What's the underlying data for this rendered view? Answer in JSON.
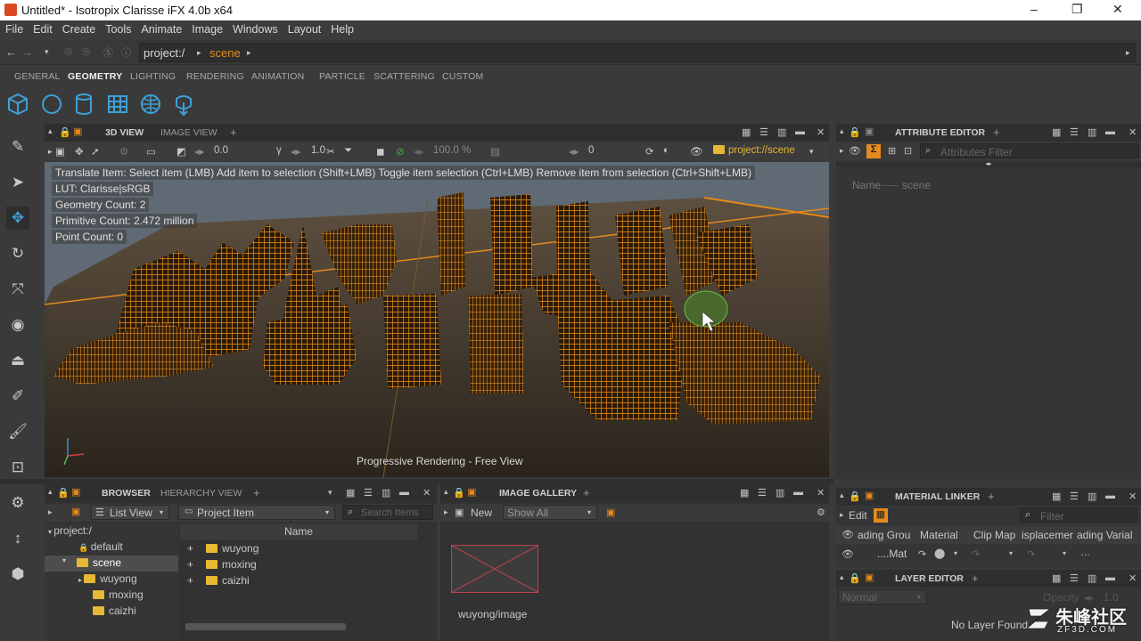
{
  "window": {
    "title": "Untitled* - Isotropix Clarisse iFX 4.0b x64",
    "minimize": "–",
    "maximize": "❐",
    "close": "✕"
  },
  "menu": [
    "File",
    "Edit",
    "Create",
    "Tools",
    "Animate",
    "Image",
    "Windows",
    "Layout",
    "Help"
  ],
  "path": {
    "root": "project:/",
    "current": "scene"
  },
  "context_tabs": [
    "GENERAL",
    "GEOMETRY",
    "LIGHTING",
    "RENDERING",
    "ANIMATION",
    "PARTICLE",
    "SCATTERING",
    "CUSTOM"
  ],
  "active_context_tab": "GEOMETRY",
  "shelf_icons": [
    "cube-icon",
    "sphere-icon",
    "cylinder-icon",
    "grid-icon",
    "geosphere-icon",
    "import-icon"
  ],
  "view_tabs": {
    "active": "3D VIEW",
    "inactive": "IMAGE VIEW",
    "add": "+"
  },
  "vp_toolbar": {
    "v1": "0.0",
    "v2": "1.0",
    "zoom": "100.0 %",
    "frame": "0",
    "context": "project://scene"
  },
  "hud": {
    "hint": "Translate Item: Select item (LMB)  Add item to selection (Shift+LMB)  Toggle item selection (Ctrl+LMB)  Remove item from selection (Ctrl+Shift+LMB)",
    "lut": "LUT: Clarisse|sRGB",
    "geometry": "Geometry Count: 2",
    "primitive": "Primitive Count: 2.472 million",
    "points": "Point Count: 0",
    "status": "Progressive Rendering - Free View"
  },
  "browser": {
    "tab_active": "BROWSER",
    "tab_inactive": "HIERARCHY VIEW",
    "view_mode": "List View",
    "filter": "Project Item",
    "search_placeholder": "Search Items",
    "column": "Name",
    "tree": {
      "root": "project:/",
      "default": "default",
      "scene": "scene",
      "children": [
        "wuyong",
        "moxing",
        "caizhi"
      ]
    },
    "items": [
      "wuyong",
      "moxing",
      "caizhi"
    ]
  },
  "gallery": {
    "tab": "IMAGE GALLERY",
    "new": "New",
    "show": "Show All",
    "image_label": "wuyong/image"
  },
  "attribute_editor": {
    "tab": "ATTRIBUTE EDITOR",
    "filter_placeholder": "Attributes Filter",
    "name_label": "Name",
    "name_value": "scene"
  },
  "material_linker": {
    "tab": "MATERIAL LINKER",
    "edit": "Edit",
    "filter_placeholder": "Filter",
    "columns": [
      "ading Grou",
      "Material",
      "Clip Map",
      "isplacemer",
      "ading Varial"
    ],
    "row_label": "....Mat"
  },
  "layer_editor": {
    "tab": "LAYER EDITOR",
    "blend": "Normal",
    "opacity_label": "Opacity",
    "opacity": "1.0",
    "status": "No Layer Found"
  },
  "watermark": {
    "text": "朱峰社区",
    "url": "ZF3D.COM"
  },
  "colors": {
    "accent": "#e58a1c",
    "wire": "#f0901a",
    "selection": "#4a8a2a",
    "icon_blue": "#3ea0d8"
  }
}
